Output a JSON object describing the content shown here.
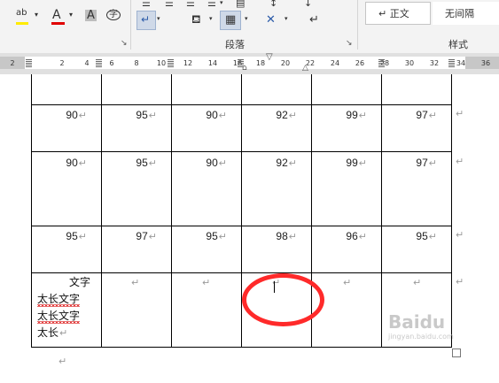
{
  "ribbon": {
    "font_group": {
      "text_highlight_icon": "ab",
      "font_color_icon": "A",
      "char_shading_icon": "A",
      "enclose_char_icon": "字"
    },
    "paragraph_group": {
      "label": "段落"
    },
    "styles_group": {
      "label": "样式",
      "style_items": [
        {
          "label": "↵ 正文"
        },
        {
          "label": "无间隔"
        }
      ]
    }
  },
  "ruler": {
    "ticks": [
      "2",
      "2",
      "4",
      "6",
      "8",
      "10",
      "12",
      "14",
      "16",
      "18",
      "20",
      "22",
      "24",
      "26",
      "28",
      "30",
      "32",
      "34",
      "36"
    ]
  },
  "table": {
    "rows": [
      {
        "cells": [
          "90",
          "95",
          "90",
          "92",
          "99",
          "97"
        ]
      },
      {
        "cells": [
          "90",
          "95",
          "90",
          "92",
          "99",
          "97"
        ]
      },
      {
        "cells": [
          "95",
          "97",
          "95",
          "98",
          "96",
          "95"
        ]
      }
    ],
    "last_row_text_lines": [
      "文字",
      "太长文字",
      "太长文字",
      "太长"
    ],
    "paragraph_mark": "↵"
  },
  "annotation": {
    "circle_color": "#ff2a2a"
  },
  "watermark": {
    "brand": "Baidu",
    "sub": "jingyan.baidu.com"
  }
}
